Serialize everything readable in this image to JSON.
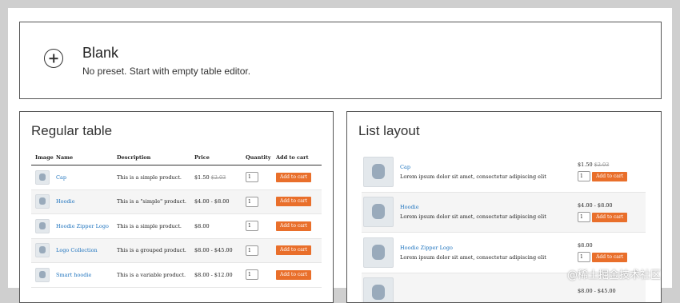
{
  "blank": {
    "title": "Blank",
    "description": "No preset. Start with empty table editor."
  },
  "regular": {
    "title": "Regular table",
    "headers": {
      "image": "Image",
      "name": "Name",
      "description": "Description",
      "price": "Price",
      "quantity": "Quantity",
      "cart": "Add to cart"
    },
    "rows": [
      {
        "name": "Cap",
        "description": "This is a simple product.",
        "price": "$1.50",
        "old_price": "$2.03",
        "qty": "1",
        "cart": "Add to cart"
      },
      {
        "name": "Hoodie",
        "description": "This is a \"simple\" product.",
        "price": "$4.00 - $8.00",
        "old_price": "",
        "qty": "1",
        "cart": "Add to cart"
      },
      {
        "name": "Hoodie Zipper Logo",
        "description": "This is a simple product.",
        "price": "$8.00",
        "old_price": "",
        "qty": "1",
        "cart": "Add to cart"
      },
      {
        "name": "Logo Collection",
        "description": "This is a grouped product.",
        "price": "$8.00 - $45.00",
        "old_price": "",
        "qty": "1",
        "cart": "Add to cart"
      },
      {
        "name": "Smart hoodie",
        "description": "This is a variable product.",
        "price": "$8.00 - $12.00",
        "old_price": "",
        "qty": "1",
        "cart": "Add to cart"
      }
    ]
  },
  "list": {
    "title": "List layout",
    "rows": [
      {
        "name": "Cap",
        "desc": "Lorem ipsum dolor sit amet, consectetur adipiscing elit",
        "price": "$1.50",
        "old_price": "$2.03",
        "qty": "1",
        "cart": "Add to cart"
      },
      {
        "name": "Hoodie",
        "desc": "Lorem ipsum dolor sit amet, consectetur adipiscing elit",
        "price": "$4.00 - $8.00",
        "old_price": "",
        "qty": "1",
        "cart": "Add to cart"
      },
      {
        "name": "Hoodie Zipper Logo",
        "desc": "Lorem ipsum dolor sit amet, consectetur adipiscing elit",
        "price": "$8.00",
        "old_price": "",
        "qty": "1",
        "cart": "Add to cart"
      },
      {
        "name": "",
        "desc": "",
        "price": "$8.00 - $45.00",
        "old_price": "",
        "qty": "",
        "cart": ""
      }
    ]
  },
  "watermark": "@稀土掘金技术社区"
}
